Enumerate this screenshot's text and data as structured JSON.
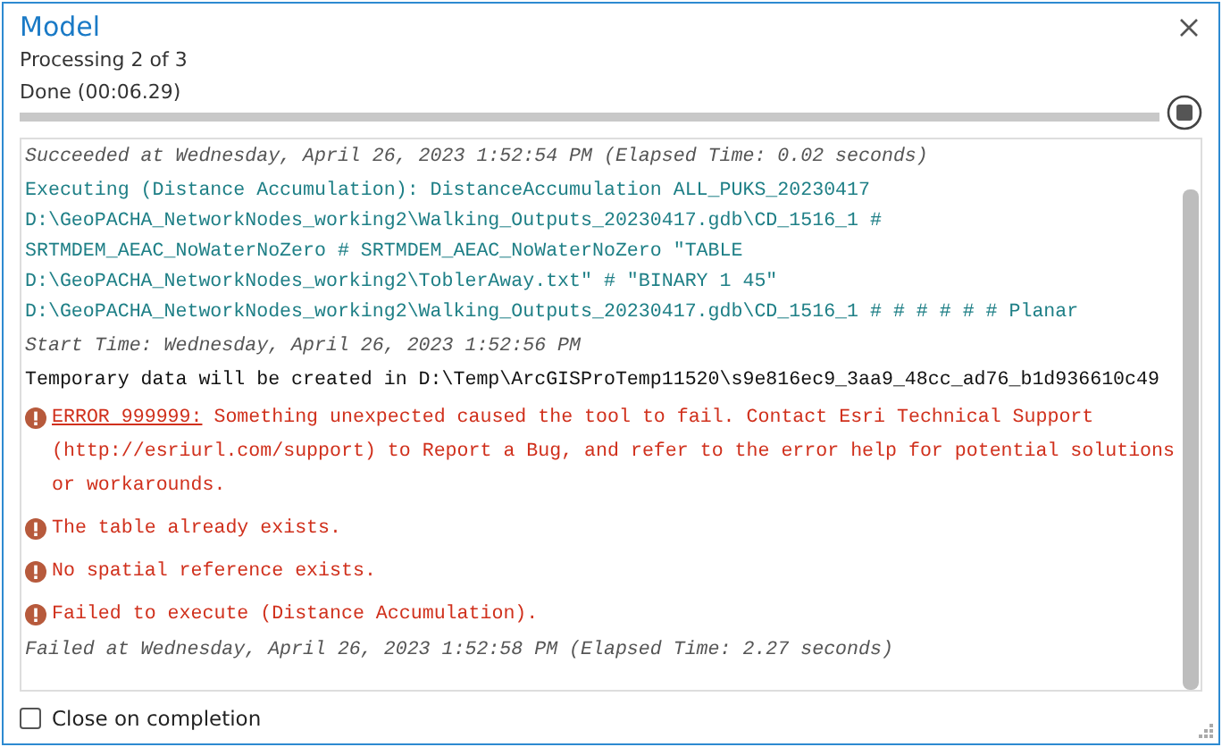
{
  "window": {
    "title": "Model"
  },
  "status": "Processing 2 of 3",
  "progress": {
    "label": "Done (00:06.29)",
    "level": 1
  },
  "messages": [
    {
      "kind": "info",
      "text": "Succeeded at Wednesday, April 26, 2023 1:52:54 PM (Elapsed Time: 0.02 seconds)"
    },
    {
      "kind": "command",
      "text": "Executing (Distance Accumulation): DistanceAccumulation ALL_PUKS_20230417\nD:\\GeoPACHA_NetworkNodes_working2\\Walking_Outputs_20230417.gdb\\CD_1516_1 #\nSRTMDEM_AEAC_NoWaterNoZero # SRTMDEM_AEAC_NoWaterNoZero \"TABLE\nD:\\GeoPACHA_NetworkNodes_working2\\ToblerAway.txt\" # \"BINARY 1 45\"\nD:\\GeoPACHA_NetworkNodes_working2\\Walking_Outputs_20230417.gdb\\CD_1516_1 # # # # # # Planar"
    },
    {
      "kind": "info",
      "text": "Start Time: Wednesday, April 26, 2023 1:52:56 PM"
    },
    {
      "kind": "plain",
      "text": "Temporary data will be created in D:\\Temp\\ArcGISProTemp11520\\s9e816ec9_3aa9_48cc_ad76_b1d936610c49"
    },
    {
      "kind": "error",
      "code": "ERROR 999999:",
      "text": "Something unexpected caused the tool to fail. Contact Esri Technical Support (http://esriurl.com/support) to Report a Bug, and refer to the error help for potential solutions or workarounds."
    },
    {
      "kind": "error",
      "text": "The table already exists."
    },
    {
      "kind": "error",
      "text": "No spatial reference exists."
    },
    {
      "kind": "error",
      "text": "Failed to execute (Distance Accumulation)."
    },
    {
      "kind": "info",
      "text": "Failed at Wednesday, April 26, 2023 1:52:58 PM (Elapsed Time: 2.27 seconds)"
    }
  ],
  "close_on_completion": {
    "label": "Close on completion",
    "checked": false
  }
}
